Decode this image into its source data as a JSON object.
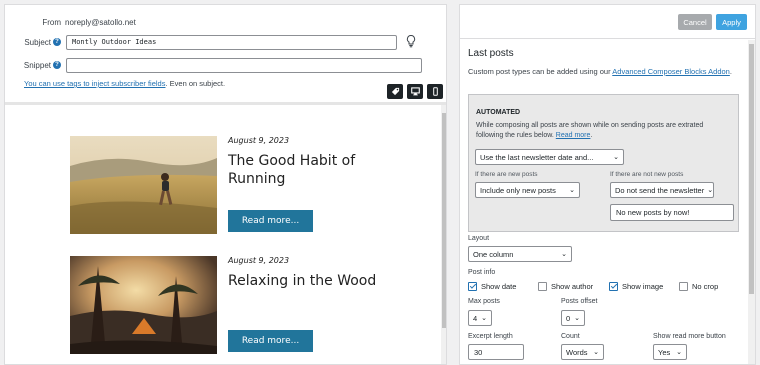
{
  "email_header": {
    "from_label": "From",
    "from_value": "noreply@satollo.net",
    "subject_label": "Subject",
    "subject_value": "Montly Outdoor Ideas",
    "snippet_label": "Snippet",
    "snippet_value": "",
    "help_link_text": "You can use tags to inject subscriber fields",
    "help_suffix": ". Even on subject.",
    "icons": [
      "help-icon",
      "lightbulb-icon",
      "tag-icon",
      "desktop-icon",
      "mobile-icon"
    ]
  },
  "posts": [
    {
      "date": "August 9, 2023",
      "title": "The Good Habit of Running",
      "button": "Read more..."
    },
    {
      "date": "August 9, 2023",
      "title": "Relaxing in the Wood",
      "button": "Read more..."
    }
  ],
  "toolbar": {
    "cancel_label": "Cancel",
    "apply_label": "Apply"
  },
  "panel": {
    "title": "Last posts",
    "desc_prefix": "Custom post types can be added using our ",
    "desc_link": "Advanced Composer Blocks Addon",
    "desc_suffix": ".",
    "automated": {
      "heading": "AUTOMATED",
      "desc": "While composing all posts are shown while on sending posts are extrated following the rules below. ",
      "read_more": "Read more",
      "read_more_suffix": ".",
      "rule_select": "Use the last newsletter date and...",
      "new_posts_label": "If there are new posts",
      "new_posts_select": "Include only new posts",
      "no_new_posts_label": "If there are not new posts",
      "no_new_posts_select": "Do not send the newsletter",
      "no_new_posts_text": "No new posts by now!"
    },
    "layout_label": "Layout",
    "layout_select": "One column",
    "post_info_label": "Post info",
    "checkboxes": [
      {
        "label": "Show date",
        "checked": true
      },
      {
        "label": "Show author",
        "checked": false
      },
      {
        "label": "Show image",
        "checked": true
      },
      {
        "label": "No crop",
        "checked": false
      }
    ],
    "max_posts_label": "Max posts",
    "max_posts_value": "4",
    "posts_offset_label": "Posts offset",
    "posts_offset_value": "0",
    "excerpt_label": "Excerpt length",
    "excerpt_value": "30",
    "count_label": "Count",
    "count_value": "Words",
    "show_read_more_label": "Show read more button",
    "show_read_more_value": "Yes"
  },
  "colors": {
    "accent": "#2271b1",
    "apply": "#3fa3e0",
    "cancel": "#a7aaad",
    "read_more": "#21759b",
    "device_button": "#1d2327"
  }
}
